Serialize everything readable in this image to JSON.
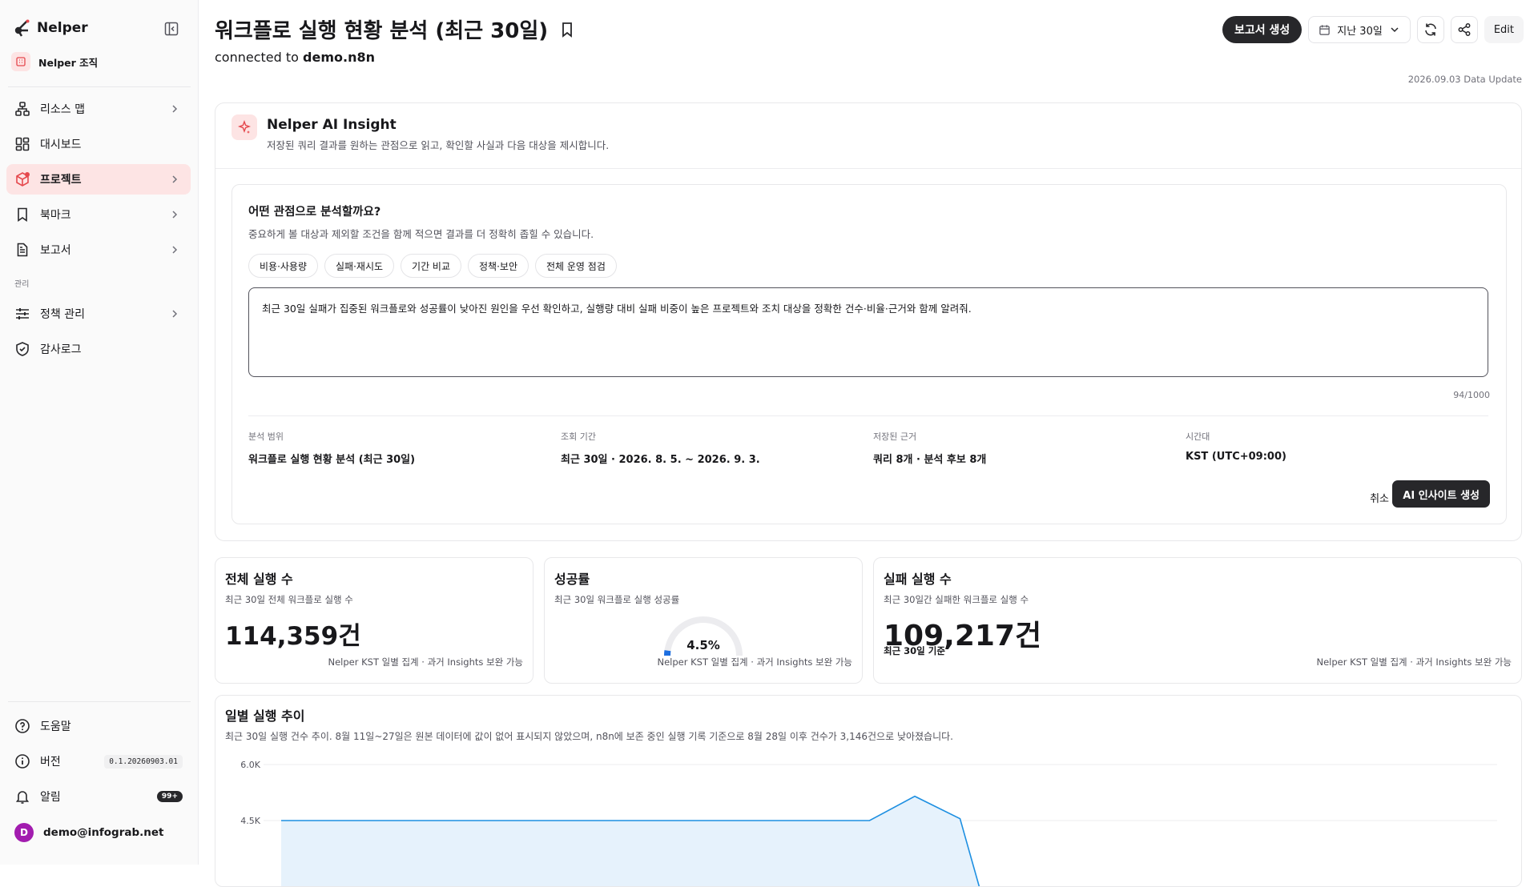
{
  "sidebar": {
    "brand": "Nelper",
    "org": "Nelper 조직",
    "nav": [
      {
        "label": "리소스 맵"
      },
      {
        "label": "대시보드"
      },
      {
        "label": "프로젝트"
      },
      {
        "label": "북마크"
      },
      {
        "label": "보고서"
      }
    ],
    "section_label": "관리",
    "admin_nav": [
      {
        "label": "정책 관리"
      },
      {
        "label": "감사로그"
      }
    ],
    "bottom": {
      "help": "도움말",
      "version_label": "버전",
      "version_value": "0.1.20260903.01",
      "alerts_label": "알림",
      "alerts_badge": "99+",
      "user_email": "demo@infograb.net",
      "user_initial": "D"
    }
  },
  "header": {
    "title": "워크플로 실행 현황 분석 (최근 30일)",
    "connected_prefix": "connected to",
    "connected_target": "demo.n8n",
    "report_button": "보고서 생성",
    "period_select": "지난 30일",
    "edit_button": "Edit",
    "data_update": "2026.09.03 Data Update"
  },
  "ai_insight": {
    "title": "Nelper AI Insight",
    "subtitle": "저장된 쿼리 결과를 원하는 관점으로 읽고, 확인할 사실과 다음 대상을 제시합니다.",
    "question": "어떤 관점으로 분석할까요?",
    "question_sub": "중요하게 볼 대상과 제외할 조건을 함께 적으면 결과를 더 정확히 좁힐 수 있습니다.",
    "chips": [
      "비용·사용량",
      "실패·재시도",
      "기간 비교",
      "정책·보안",
      "전체 운영 점검"
    ],
    "prompt": "최근 30일 실패가 집중된 워크플로와 성공률이 낮아진 원인을 우선 확인하고, 실행량 대비 실패 비중이 높은 프로젝트와 조치 대상을 정확한 건수·비율·근거와 함께 알려줘.",
    "char_count": "94/1000",
    "meta": [
      {
        "key": "분석 범위",
        "value": "워크플로 실행 현황 분석 (최근 30일)"
      },
      {
        "key": "조회 기간",
        "value": "최근 30일 · 2026. 8. 5. ~ 2026. 9. 3."
      },
      {
        "key": "저장된 근거",
        "value": "쿼리 8개 · 분석 후보 8개"
      },
      {
        "key": "시간대",
        "value": "KST (UTC+09:00)"
      }
    ],
    "cancel": "취소",
    "generate": "AI 인사이트 생성"
  },
  "cards": [
    {
      "title": "전체 실행 수",
      "subtitle": "최근 30일 전체 워크플로 실행 수",
      "value": "114,359건",
      "footer": "Nelper KST 일별 집계 · 과거 Insights 보완 가능"
    },
    {
      "title": "성공률",
      "subtitle": "최근 30일 워크플로 실행 성공률",
      "value": "4.5%",
      "gauge_fraction": 0.045,
      "footer": "Nelper KST 일별 집계 · 과거 Insights 보완 가능"
    },
    {
      "title": "실패 실행 수",
      "subtitle": "최근 30일간 실패한 워크플로 실행 수",
      "value": "109,217건",
      "note": "최근 30일 기준",
      "footer": "Nelper KST 일별 집계 · 과거 Insights 보완 가능"
    }
  ],
  "trend": {
    "title": "일별 실행 추이",
    "subtitle": "최근 30일 실행 건수 추이. 8월 11일~27일은 원본 데이터에 값이 없어 표시되지 않았으며, n8n에 보존 중인 실행 기록 기준으로 8월 28일 이후 건수가 3,146건으로 낮아졌습니다."
  },
  "chart_data": {
    "type": "area",
    "title": "일별 실행 추이",
    "y_tick_labels": [
      "6.0K",
      "4.5K"
    ],
    "ylim": [
      0,
      6000
    ],
    "x": [
      0,
      1,
      2,
      3,
      4,
      5,
      6,
      7,
      8,
      9,
      10,
      11,
      12,
      13,
      14,
      15
    ],
    "values": [
      4500,
      4500,
      4500,
      4500,
      4500,
      4500,
      4500,
      4500,
      4500,
      4500,
      4500,
      4500,
      4500,
      4500,
      5150,
      4550
    ],
    "trailing_drop": true,
    "color": "#1d8fe1",
    "fill": "#e6f2fc",
    "grid": true
  },
  "colors": {
    "accent": "#e5484d",
    "dark": "#27272a",
    "chart": "#1d8fe1"
  }
}
